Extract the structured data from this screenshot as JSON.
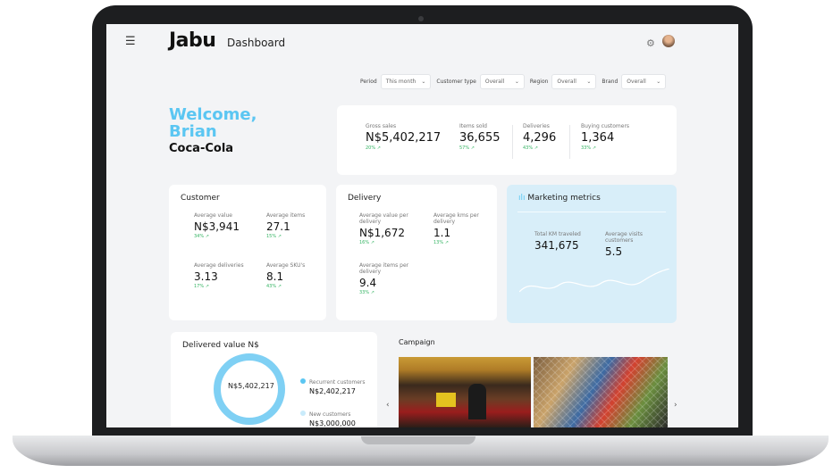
{
  "app": {
    "logo": "Jabu",
    "title": "Dashboard"
  },
  "filters": [
    {
      "label": "Period",
      "value": "This month"
    },
    {
      "label": "Customer type",
      "value": "Overall"
    },
    {
      "label": "Region",
      "value": "Overall"
    },
    {
      "label": "Brand",
      "value": "Overall"
    }
  ],
  "welcome": {
    "greeting": "Welcome,",
    "name": "Brian",
    "company": "Coca-Cola"
  },
  "top_kpis": [
    {
      "label": "Gross sales",
      "value": "N$5,402,217",
      "change": "20% ↗"
    },
    {
      "label": "Items sold",
      "value": "36,655",
      "change": "57% ↗"
    },
    {
      "label": "Deliveries",
      "value": "4,296",
      "change": "43% ↗"
    },
    {
      "label": "Buying customers",
      "value": "1,364",
      "change": "33% ↗"
    }
  ],
  "customer": {
    "title": "Customer",
    "metrics": [
      {
        "label": "Average value",
        "value": "N$3,941",
        "change": "34% ↗"
      },
      {
        "label": "Average items",
        "value": "27.1",
        "change": "15% ↗"
      },
      {
        "label": "Average deliveries",
        "value": "3.13",
        "change": "17% ↗"
      },
      {
        "label": "Average SKU's",
        "value": "8.1",
        "change": "43% ↗"
      }
    ]
  },
  "delivery": {
    "title": "Delivery",
    "metrics": [
      {
        "label": "Average value per delivery",
        "value": "N$1,672",
        "change": "16% ↗"
      },
      {
        "label": "Average kms per delivery",
        "value": "1.1",
        "change": "13% ↗"
      },
      {
        "label": "Average items per delivery",
        "value": "9.4",
        "change": "33% ↗"
      }
    ]
  },
  "marketing": {
    "title": "Marketing metrics",
    "metrics": [
      {
        "label": "Total KM traveled",
        "value": "341,675"
      },
      {
        "label": "Average visits customers",
        "value": "5.5"
      }
    ]
  },
  "delivered_value": {
    "title": "Delivered value N$",
    "center": "N$5,402,217",
    "legend": [
      {
        "label": "Recurrent customers",
        "value": "N$2,402,217"
      },
      {
        "label": "New customers",
        "value": "N$3,000,000"
      }
    ]
  },
  "campaign": {
    "title": "Campaign"
  },
  "colors": {
    "accent": "#5bc6f2",
    "positive": "#35b463",
    "marketing_bg": "#d8eef9"
  }
}
